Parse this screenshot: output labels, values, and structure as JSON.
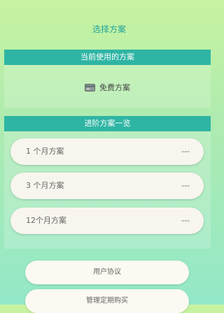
{
  "page": {
    "title": "选择方案"
  },
  "current_section": {
    "header": "当前使用的方案",
    "plan_name": "免费方案",
    "plan_icon": "credit-card-icon"
  },
  "advanced_section": {
    "header": "进阶方案一览",
    "plans": [
      {
        "name": "1 个月方案",
        "price": "---"
      },
      {
        "name": "3 个月方案",
        "price": "---"
      },
      {
        "name": "12个月方案",
        "price": "---"
      }
    ]
  },
  "buttons": {
    "user_agreement": "用户协议",
    "manage_subscription": "管理定期购买"
  },
  "colors": {
    "accent": "#2fb5a4",
    "title_text": "#23a39a"
  }
}
